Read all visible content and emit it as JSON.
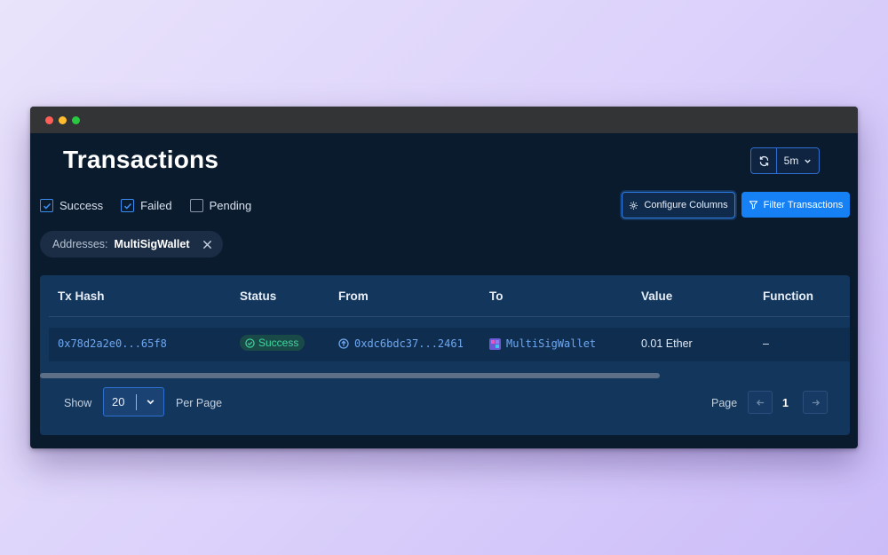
{
  "header": {
    "title": "Transactions",
    "refresh_interval": "5m"
  },
  "status_filters": [
    {
      "label": "Success",
      "checked": true
    },
    {
      "label": "Failed",
      "checked": true
    },
    {
      "label": "Pending",
      "checked": false
    }
  ],
  "buttons": {
    "configure_columns": "Configure Columns",
    "filter_transactions": "Filter Transactions"
  },
  "filter_chip": {
    "label": "Addresses:",
    "value": "MultiSigWallet"
  },
  "table": {
    "columns": [
      "Tx Hash",
      "Status",
      "From",
      "To",
      "Value",
      "Function"
    ],
    "rows": [
      {
        "tx_hash": "0x78d2a2e0...65f8",
        "status": "Success",
        "from": "0xdc6bdc37...2461",
        "to": "MultiSigWallet",
        "value": "0.01 Ether",
        "function": "–"
      }
    ]
  },
  "pagination": {
    "show_label": "Show",
    "per_page_value": "20",
    "per_page_label": "Per Page",
    "page_label": "Page",
    "current_page": "1"
  },
  "colors": {
    "accent": "#1681f5",
    "success": "#3ed6a0",
    "link": "#6fa8f0",
    "panel": "#13365c",
    "window_bg": "#0b1b2e"
  }
}
